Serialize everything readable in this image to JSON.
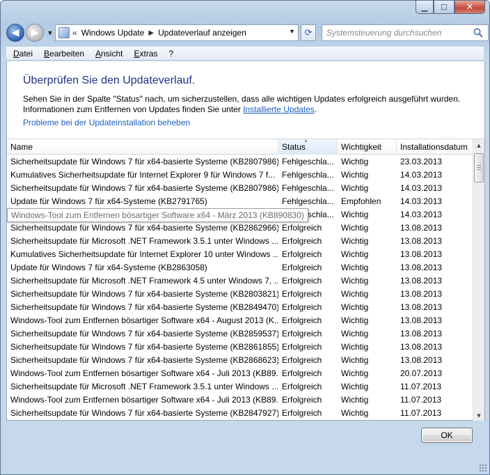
{
  "window": {
    "caption_buttons": {
      "minimize": "minimize-icon",
      "maximize": "maximize-icon",
      "close": "close-icon"
    }
  },
  "navigation": {
    "back_icon": "back-arrow-icon",
    "forward_icon": "forward-arrow-icon",
    "breadcrumbs": [
      "Windows Update",
      "Updateverlauf anzeigen"
    ],
    "overflow_chevron": "«",
    "search_placeholder": "Systemsteuerung durchsuchen"
  },
  "menubar": [
    "Datei",
    "Bearbeiten",
    "Ansicht",
    "Extras",
    "?"
  ],
  "content": {
    "title": "Überprüfen Sie den Updateverlauf.",
    "desc_line1": "Sehen Sie in der Spalte \"Status\" nach, um sicherzustellen, dass alle wichtigen Updates erfolgreich ausgeführt wurden.",
    "desc_line2_prefix": "Informationen zum Entfernen von Updates finden Sie unter ",
    "desc_link": "Installierte Updates",
    "desc_line2_suffix": ".",
    "trouble_link": "Probleme bei der Updateinstallation beheben"
  },
  "table": {
    "columns": [
      "Name",
      "Status",
      "Wichtigkeit",
      "Installationsdatum"
    ],
    "sorted_column": "Status",
    "rows": [
      [
        "Sicherheitsupdate für Windows 7 für x64-basierte Systeme (KB2807986)",
        "Fehlgeschla...",
        "Wichtig",
        "23.03.2013"
      ],
      [
        "Kumulatives Sicherheitsupdate für Internet Explorer 9 für Windows 7 f...",
        "Fehlgeschla...",
        "Wichtig",
        "14.03.2013"
      ],
      [
        "Sicherheitsupdate für Windows 7 für x64-basierte Systeme (KB2807986)",
        "Fehlgeschla...",
        "Wichtig",
        "14.03.2013"
      ],
      [
        "Update für Windows 7 für x64-Systeme (KB2791765)",
        "Fehlgeschla...",
        "Empfohlen",
        "14.03.2013"
      ],
      [
        "Windows-Tool zum Entfernen bösartiger Software x64 - März 2013 (KB890830)",
        "Fehlgeschla...",
        "Wichtig",
        "14.03.2013"
      ],
      [
        "Sicherheitsupdate für Windows 7 für x64-basierte Systeme (KB2862966)",
        "Erfolgreich",
        "Wichtig",
        "13.08.2013"
      ],
      [
        "Sicherheitsupdate für Microsoft .NET Framework 3.5.1 unter Windows ...",
        "Erfolgreich",
        "Wichtig",
        "13.08.2013"
      ],
      [
        "Kumulatives Sicherheitsupdate für Internet Explorer 10 unter Windows ...",
        "Erfolgreich",
        "Wichtig",
        "13.08.2013"
      ],
      [
        "Update für Windows 7 für x64-Systeme (KB2863058)",
        "Erfolgreich",
        "Wichtig",
        "13.08.2013"
      ],
      [
        "Sicherheitsupdate für Microsoft .NET Framework 4.5 unter Windows 7, ...",
        "Erfolgreich",
        "Wichtig",
        "13.08.2013"
      ],
      [
        "Sicherheitsupdate für Windows 7 für x64-basierte Systeme (KB2803821)",
        "Erfolgreich",
        "Wichtig",
        "13.08.2013"
      ],
      [
        "Sicherheitsupdate für Windows 7 für x64-basierte Systeme (KB2849470)",
        "Erfolgreich",
        "Wichtig",
        "13.08.2013"
      ],
      [
        "Windows-Tool zum Entfernen bösartiger Software x64 - August 2013 (K...",
        "Erfolgreich",
        "Wichtig",
        "13.08.2013"
      ],
      [
        "Sicherheitsupdate für Windows 7 für x64-basierte Systeme (KB2859537)",
        "Erfolgreich",
        "Wichtig",
        "13.08.2013"
      ],
      [
        "Sicherheitsupdate für Windows 7 für x64-basierte Systeme (KB2861855)",
        "Erfolgreich",
        "Wichtig",
        "13.08.2013"
      ],
      [
        "Sicherheitsupdate für Windows 7 für x64-basierte Systeme (KB2868623)",
        "Erfolgreich",
        "Wichtig",
        "13.08.2013"
      ],
      [
        "Windows-Tool zum Entfernen bösartiger Software x64 - Juli 2013 (KB89...",
        "Erfolgreich",
        "Wichtig",
        "20.07.2013"
      ],
      [
        "Sicherheitsupdate für Microsoft .NET Framework 3.5.1 unter Windows ...",
        "Erfolgreich",
        "Wichtig",
        "11.07.2013"
      ],
      [
        "Windows-Tool zum Entfernen bösartiger Software x64 - Juli 2013 (KB89...",
        "Erfolgreich",
        "Wichtig",
        "11.07.2013"
      ],
      [
        "Sicherheitsupdate für Windows 7 für x64-basierte Systeme (KB2847927)",
        "Erfolgreich",
        "Wichtig",
        "11.07.2013"
      ]
    ],
    "tooltip": "Windows-Tool zum Entfernen bösartiger Software x64 - März 2013 (KB890830)"
  },
  "ok_button": "OK",
  "colors": {
    "title": "#1e3287",
    "link": "#1a5ec2",
    "frame": "#b4cbe4"
  }
}
